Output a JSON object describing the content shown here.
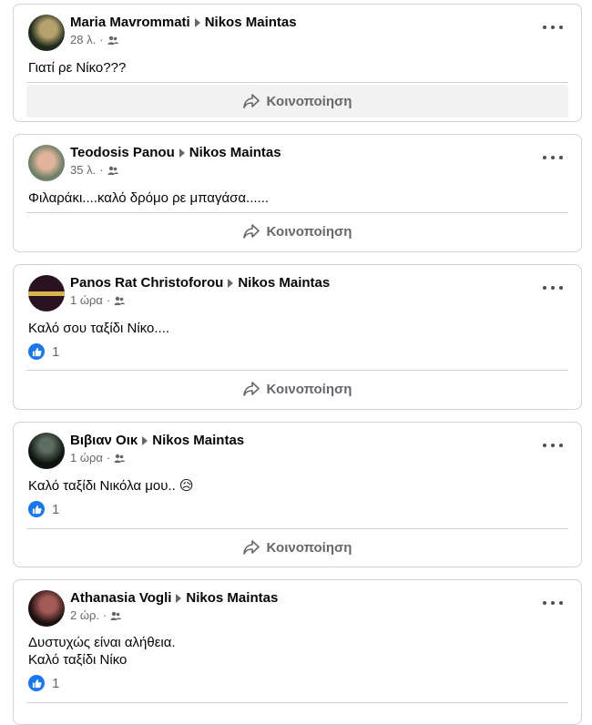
{
  "posts": [
    {
      "author": "Maria Mavrommati",
      "target": "Nikos Maintas",
      "time": "28 λ.",
      "text_lines": [
        "Γιατί ρε Νίκο???"
      ],
      "likes": null,
      "share_label": "Κοινοποίηση",
      "avatar_colors": [
        "#1e2a1c",
        "#b6a26d"
      ]
    },
    {
      "author": "Teodosis Panou",
      "target": "Nikos Maintas",
      "time": "35 λ.",
      "text_lines": [
        "Φιλαράκι....καλό δρόμο ρε μπαγάσα......"
      ],
      "likes": null,
      "share_label": "Κοινοποίηση",
      "avatar_colors": [
        "#6f8068",
        "#e0b39a"
      ]
    },
    {
      "author": "Panos Rat Christoforou",
      "target": "Nikos Maintas",
      "time": "1 ώρα",
      "text_lines": [
        "Καλό σου ταξίδι Νίκο...."
      ],
      "likes": "1",
      "share_label": "Κοινοποίηση",
      "avatar_colors": [
        "#2a1320",
        "#d8b24a"
      ]
    },
    {
      "author": "Βιβιαν Οικ",
      "target": "Nikos Maintas",
      "time": "1 ώρα",
      "text_lines": [
        "Καλό ταξίδι Νικόλα μου.. 😥"
      ],
      "likes": "1",
      "share_label": "Κοινοποίηση",
      "avatar_colors": [
        "#0e1511",
        "#5d6d5f"
      ]
    },
    {
      "author": "Athanasia Vogli",
      "target": "Nikos Maintas",
      "time": "2 ώρ.",
      "text_lines": [
        "Δυστυχώς είναι αλήθεια.",
        "Καλό ταξίδι Νίκο"
      ],
      "likes": "1",
      "share_label": null,
      "avatar_colors": [
        "#1c0f10",
        "#a35b56"
      ]
    }
  ],
  "colors": {
    "like_blue": "#1877f2",
    "secondary_text": "#65676b"
  }
}
